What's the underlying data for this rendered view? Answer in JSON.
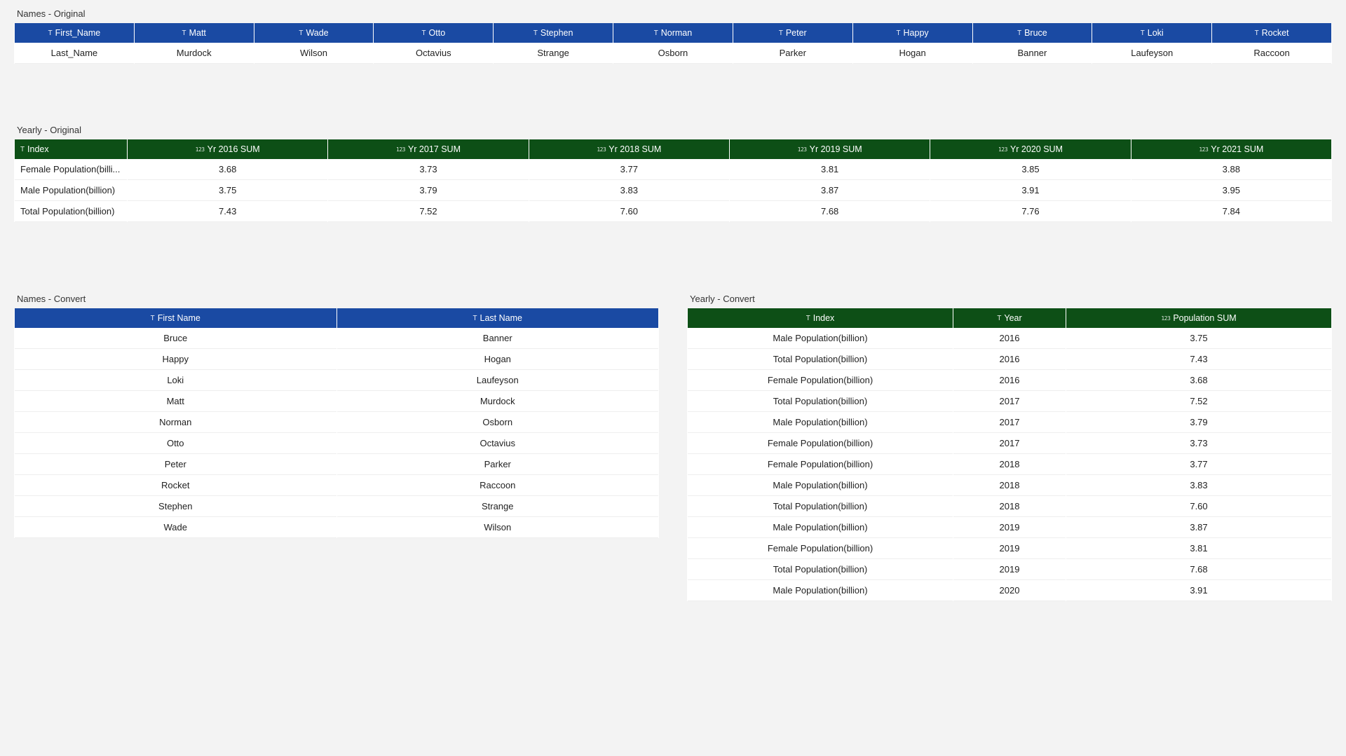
{
  "names_original": {
    "title": "Names - Original",
    "headers": [
      "First_Name",
      "Matt",
      "Wade",
      "Otto",
      "Stephen",
      "Norman",
      "Peter",
      "Happy",
      "Bruce",
      "Loki",
      "Rocket"
    ],
    "row": [
      "Last_Name",
      "Murdock",
      "Wilson",
      "Octavius",
      "Strange",
      "Osborn",
      "Parker",
      "Hogan",
      "Banner",
      "Laufeyson",
      "Raccoon"
    ]
  },
  "yearly_original": {
    "title": "Yearly - Original",
    "headers": [
      "Index",
      "Yr 2016 SUM",
      "Yr 2017 SUM",
      "Yr 2018 SUM",
      "Yr 2019 SUM",
      "Yr 2020 SUM",
      "Yr 2021 SUM"
    ],
    "rows": [
      [
        "Female Population(billi...",
        "3.68",
        "3.73",
        "3.77",
        "3.81",
        "3.85",
        "3.88"
      ],
      [
        "Male Population(billion)",
        "3.75",
        "3.79",
        "3.83",
        "3.87",
        "3.91",
        "3.95"
      ],
      [
        "Total Population(billion)",
        "7.43",
        "7.52",
        "7.60",
        "7.68",
        "7.76",
        "7.84"
      ]
    ]
  },
  "names_convert": {
    "title": "Names - Convert",
    "headers": [
      "First Name",
      "Last Name"
    ],
    "rows": [
      [
        "Bruce",
        "Banner"
      ],
      [
        "Happy",
        "Hogan"
      ],
      [
        "Loki",
        "Laufeyson"
      ],
      [
        "Matt",
        "Murdock"
      ],
      [
        "Norman",
        "Osborn"
      ],
      [
        "Otto",
        "Octavius"
      ],
      [
        "Peter",
        "Parker"
      ],
      [
        "Rocket",
        "Raccoon"
      ],
      [
        "Stephen",
        "Strange"
      ],
      [
        "Wade",
        "Wilson"
      ]
    ]
  },
  "yearly_convert": {
    "title": "Yearly - Convert",
    "headers": [
      "Index",
      "Year",
      "Population SUM"
    ],
    "header_types": [
      "t",
      "t",
      "n"
    ],
    "rows": [
      [
        "Male Population(billion)",
        "2016",
        "3.75"
      ],
      [
        "Total Population(billion)",
        "2016",
        "7.43"
      ],
      [
        "Female Population(billion)",
        "2016",
        "3.68"
      ],
      [
        "Total Population(billion)",
        "2017",
        "7.52"
      ],
      [
        "Male Population(billion)",
        "2017",
        "3.79"
      ],
      [
        "Female Population(billion)",
        "2017",
        "3.73"
      ],
      [
        "Female Population(billion)",
        "2018",
        "3.77"
      ],
      [
        "Male Population(billion)",
        "2018",
        "3.83"
      ],
      [
        "Total Population(billion)",
        "2018",
        "7.60"
      ],
      [
        "Male Population(billion)",
        "2019",
        "3.87"
      ],
      [
        "Female Population(billion)",
        "2019",
        "3.81"
      ],
      [
        "Total Population(billion)",
        "2019",
        "7.68"
      ],
      [
        "Male Population(billion)",
        "2020",
        "3.91"
      ]
    ]
  },
  "chart_data": [
    {
      "type": "table",
      "title": "Names - Original",
      "columns": [
        "First_Name",
        "Matt",
        "Wade",
        "Otto",
        "Stephen",
        "Norman",
        "Peter",
        "Happy",
        "Bruce",
        "Loki",
        "Rocket"
      ],
      "rows": [
        [
          "Last_Name",
          "Murdock",
          "Wilson",
          "Octavius",
          "Strange",
          "Osborn",
          "Parker",
          "Hogan",
          "Banner",
          "Laufeyson",
          "Raccoon"
        ]
      ]
    },
    {
      "type": "table",
      "title": "Yearly - Original",
      "columns": [
        "Index",
        "Yr 2016 SUM",
        "Yr 2017 SUM",
        "Yr 2018 SUM",
        "Yr 2019 SUM",
        "Yr 2020 SUM",
        "Yr 2021 SUM"
      ],
      "rows": [
        [
          "Female Population(billion)",
          3.68,
          3.73,
          3.77,
          3.81,
          3.85,
          3.88
        ],
        [
          "Male Population(billion)",
          3.75,
          3.79,
          3.83,
          3.87,
          3.91,
          3.95
        ],
        [
          "Total Population(billion)",
          7.43,
          7.52,
          7.6,
          7.68,
          7.76,
          7.84
        ]
      ]
    },
    {
      "type": "table",
      "title": "Names - Convert",
      "columns": [
        "First Name",
        "Last Name"
      ],
      "rows": [
        [
          "Bruce",
          "Banner"
        ],
        [
          "Happy",
          "Hogan"
        ],
        [
          "Loki",
          "Laufeyson"
        ],
        [
          "Matt",
          "Murdock"
        ],
        [
          "Norman",
          "Osborn"
        ],
        [
          "Otto",
          "Octavius"
        ],
        [
          "Peter",
          "Parker"
        ],
        [
          "Rocket",
          "Raccoon"
        ],
        [
          "Stephen",
          "Strange"
        ],
        [
          "Wade",
          "Wilson"
        ]
      ]
    },
    {
      "type": "table",
      "title": "Yearly - Convert",
      "columns": [
        "Index",
        "Year",
        "Population SUM"
      ],
      "rows": [
        [
          "Male Population(billion)",
          2016,
          3.75
        ],
        [
          "Total Population(billion)",
          2016,
          7.43
        ],
        [
          "Female Population(billion)",
          2016,
          3.68
        ],
        [
          "Total Population(billion)",
          2017,
          7.52
        ],
        [
          "Male Population(billion)",
          2017,
          3.79
        ],
        [
          "Female Population(billion)",
          2017,
          3.73
        ],
        [
          "Female Population(billion)",
          2018,
          3.77
        ],
        [
          "Male Population(billion)",
          2018,
          3.83
        ],
        [
          "Total Population(billion)",
          2018,
          7.6
        ],
        [
          "Male Population(billion)",
          2019,
          3.87
        ],
        [
          "Female Population(billion)",
          2019,
          3.81
        ],
        [
          "Total Population(billion)",
          2019,
          7.68
        ],
        [
          "Male Population(billion)",
          2020,
          3.91
        ]
      ]
    }
  ]
}
